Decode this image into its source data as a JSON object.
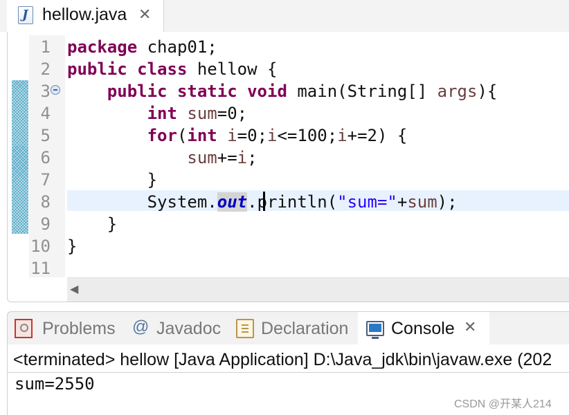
{
  "editor": {
    "tab": {
      "icon": "java-file-icon",
      "icon_letter": "J",
      "title": "hellow.java",
      "close": "✕"
    },
    "lines": [
      {
        "n": "1"
      },
      {
        "n": "2"
      },
      {
        "n": "3"
      },
      {
        "n": "4"
      },
      {
        "n": "5"
      },
      {
        "n": "6"
      },
      {
        "n": "7"
      },
      {
        "n": "8"
      },
      {
        "n": "9"
      },
      {
        "n": "10"
      },
      {
        "n": "11"
      }
    ],
    "code": {
      "l1": {
        "kw": "package",
        "rest": " chap01;"
      },
      "l2": {
        "kw1": "public",
        "kw2": "class",
        "rest": " hellow {"
      },
      "l3": {
        "kw1": "public",
        "kw2": "static",
        "kw3": "void",
        "rest1": " main(String[] ",
        "var": "args",
        "rest2": "){"
      },
      "l4": {
        "kw": "int",
        "var": "sum",
        "rest": "=0;"
      },
      "l5": {
        "kw1": "for",
        "p1": "(",
        "kw2": "int",
        "v1": "i",
        "p2": "=0;",
        "v2": "i",
        "p3": "<=100;",
        "v3": "i",
        "p4": "+=2) {"
      },
      "l6": {
        "var": "sum",
        "p1": "+=",
        "v2": "i",
        "p2": ";"
      },
      "l7": {
        "text": "}"
      },
      "l8": {
        "p1": "System.",
        "field": "out",
        "p2": ".println(",
        "str": "\"sum=\"",
        "p3": "+",
        "var": "sum",
        "p4": ");"
      },
      "l9": {
        "text": "}"
      },
      "l10": {
        "text": "}"
      }
    },
    "scroll_left": "◀"
  },
  "views": {
    "tabs": [
      {
        "label": "Problems",
        "icon": "problems-icon"
      },
      {
        "label": "Javadoc",
        "icon": "javadoc-icon",
        "glyph": "@"
      },
      {
        "label": "Declaration",
        "icon": "declaration-icon"
      },
      {
        "label": "Console",
        "icon": "console-icon",
        "active": true,
        "close": "✕"
      }
    ]
  },
  "console": {
    "header": "<terminated> hellow [Java Application] D:\\Java_jdk\\bin\\javaw.exe (202",
    "output": "sum=2550"
  },
  "watermark": "CSDN @开某人214"
}
